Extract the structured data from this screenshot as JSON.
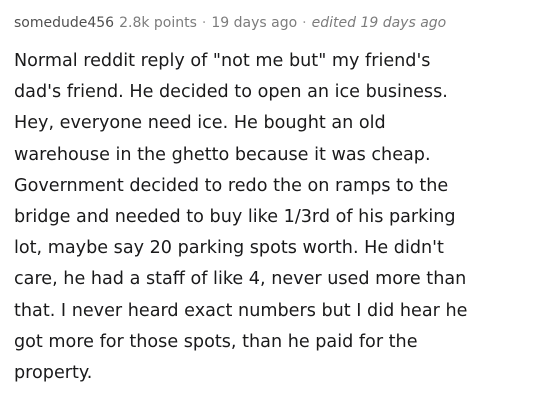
{
  "comment": {
    "author": "somedude456",
    "points": "2.8k points",
    "separator": "·",
    "time": "19 days ago",
    "edited": "edited 19 days ago",
    "body_lines": [
      "Normal reddit reply of \"not me but\" my friend's",
      "dad's friend. He decided to open an ice business.",
      "Hey, everyone need ice. He bought an old",
      "warehouse in the ghetto because it was cheap.",
      "Government decided to redo the on ramps to the",
      "bridge and needed to buy like 1/3rd of his parking",
      "lot, maybe say 20 parking spots worth. He didn't",
      "care, he had a staff of like 4, never used more than",
      "that. I never heard exact numbers but I did hear he",
      "got more for those spots, than he paid for the",
      "property."
    ]
  }
}
